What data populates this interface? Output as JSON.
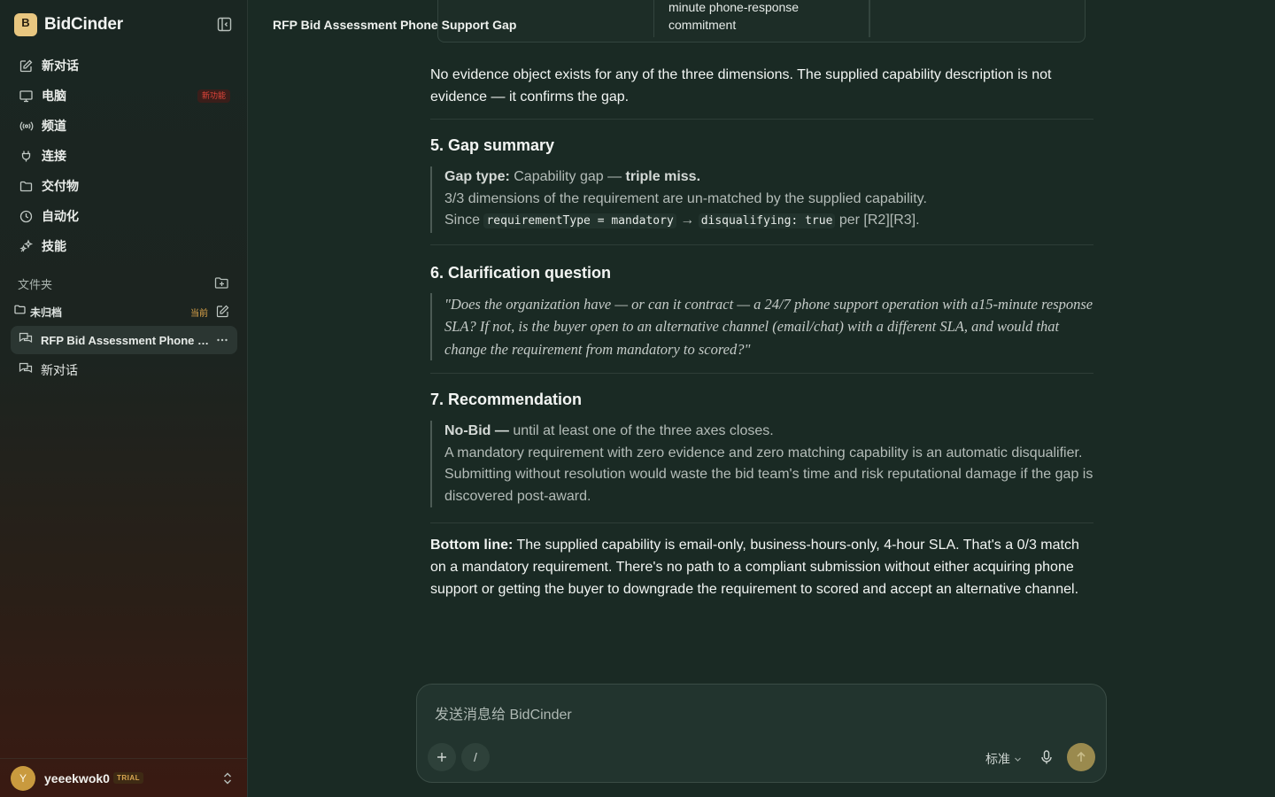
{
  "app": {
    "name": "BidCinder",
    "logo_letter": "B"
  },
  "sidebar": {
    "nav": [
      {
        "label": "新对话",
        "icon": "compose-icon"
      },
      {
        "label": "电脑",
        "icon": "monitor-icon",
        "badge": "新功能"
      },
      {
        "label": "频道",
        "icon": "broadcast-icon"
      },
      {
        "label": "连接",
        "icon": "plug-icon"
      },
      {
        "label": "交付物",
        "icon": "folder-icon"
      },
      {
        "label": "自动化",
        "icon": "clock-icon"
      },
      {
        "label": "技能",
        "icon": "sparkles-icon"
      }
    ],
    "folders_label": "文件夹",
    "folder": {
      "label": "未归档",
      "current": "当前"
    },
    "chats": [
      {
        "label": "RFP Bid Assessment Phone Support Gap",
        "active": true
      },
      {
        "label": "新对话",
        "active": false
      }
    ],
    "user": {
      "initial": "Y",
      "name": "yeeekwok0",
      "plan": "TRIAL"
    }
  },
  "main": {
    "conversation_title": "RFP Bid Assessment Phone Support Gap",
    "table_fragment": {
      "cell_text_line1": "minute phone-response",
      "cell_text_line2": "commitment"
    },
    "evidence_para": "No evidence object exists for any of the three dimensions. The supplied capability description is not evidence — it confirms the gap.",
    "gap": {
      "heading": "5. Gap summary",
      "type_label": "Gap type:",
      "type_text": " Capability gap — ",
      "type_strong": "triple miss.",
      "line2": "3/3 dimensions of the requirement are un-matched by the supplied capability.",
      "line3_pre": "Since ",
      "code1": "requirementType = mandatory",
      "arrow": " → ",
      "code2": "disqualifying: true",
      "line3_post": " per [R2][R3]."
    },
    "clarification": {
      "heading": "6. Clarification question",
      "text": "\"Does the organization have — or can it contract — a 24/7 phone support operation with a15-minute response SLA? If not, is the buyer open to an alternative channel (email/chat) with a different SLA, and would that change the requirement from mandatory to scored?\""
    },
    "recommendation": {
      "heading": "7. Recommendation",
      "verdict": "No-Bid —",
      "verdict_text": " until at least one of the three axes closes.",
      "detail": "A mandatory requirement with zero evidence and zero matching capability is an automatic disqualifier. Submitting without resolution would waste the bid team's time and risk reputational damage if the gap is discovered post-award."
    },
    "bottom_line": {
      "label": "Bottom line:",
      "text": " The supplied capability is email-only, business-hours-only, 4-hour SLA. That's a 0/3 match on a mandatory requirement. There's no path to a compliant submission without either acquiring phone support or getting the buyer to downgrade the requirement to scored and accept an alternative channel."
    }
  },
  "composer": {
    "placeholder": "发送消息给 BidCinder",
    "slash": "/",
    "mode": "标准"
  },
  "colors": {
    "accent": "#e8c680",
    "badge_red": "#e0453a",
    "current_orange": "#e0a64a",
    "send": "#9a8a4e"
  }
}
